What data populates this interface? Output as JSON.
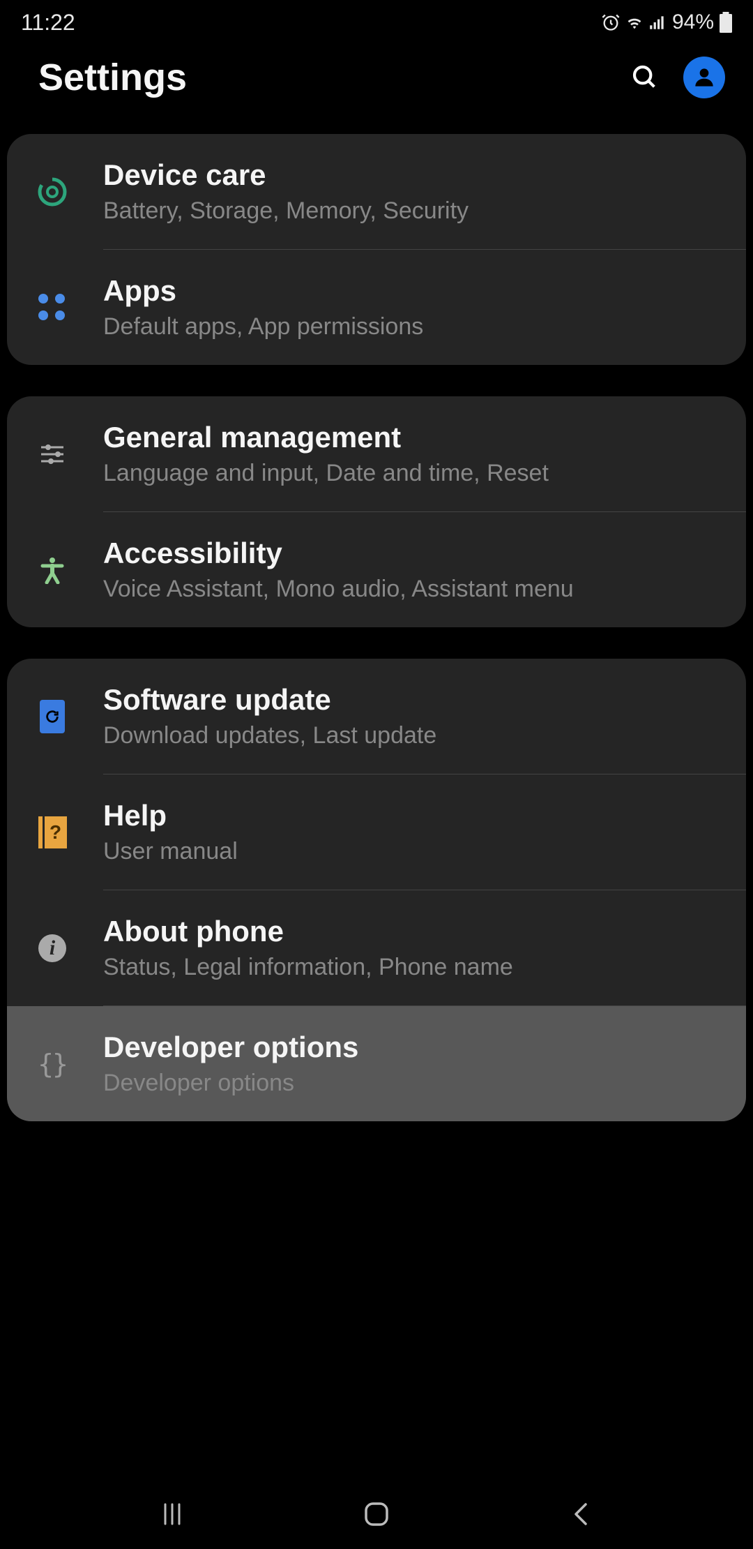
{
  "status_bar": {
    "time": "11:22",
    "battery_percent": "94%"
  },
  "header": {
    "title": "Settings"
  },
  "groups": [
    {
      "items": [
        {
          "icon": "device-care",
          "title": "Device care",
          "subtitle": "Battery, Storage, Memory, Security"
        },
        {
          "icon": "apps",
          "title": "Apps",
          "subtitle": "Default apps, App permissions"
        }
      ]
    },
    {
      "items": [
        {
          "icon": "general-management",
          "title": "General management",
          "subtitle": "Language and input, Date and time, Reset"
        },
        {
          "icon": "accessibility",
          "title": "Accessibility",
          "subtitle": "Voice Assistant, Mono audio, Assistant menu"
        }
      ]
    },
    {
      "items": [
        {
          "icon": "software-update",
          "title": "Software update",
          "subtitle": "Download updates, Last update"
        },
        {
          "icon": "help",
          "title": "Help",
          "subtitle": "User manual"
        },
        {
          "icon": "about-phone",
          "title": "About phone",
          "subtitle": "Status, Legal information, Phone name"
        },
        {
          "icon": "developer-options",
          "title": "Developer options",
          "subtitle": "Developer options",
          "highlighted": true
        }
      ]
    }
  ]
}
